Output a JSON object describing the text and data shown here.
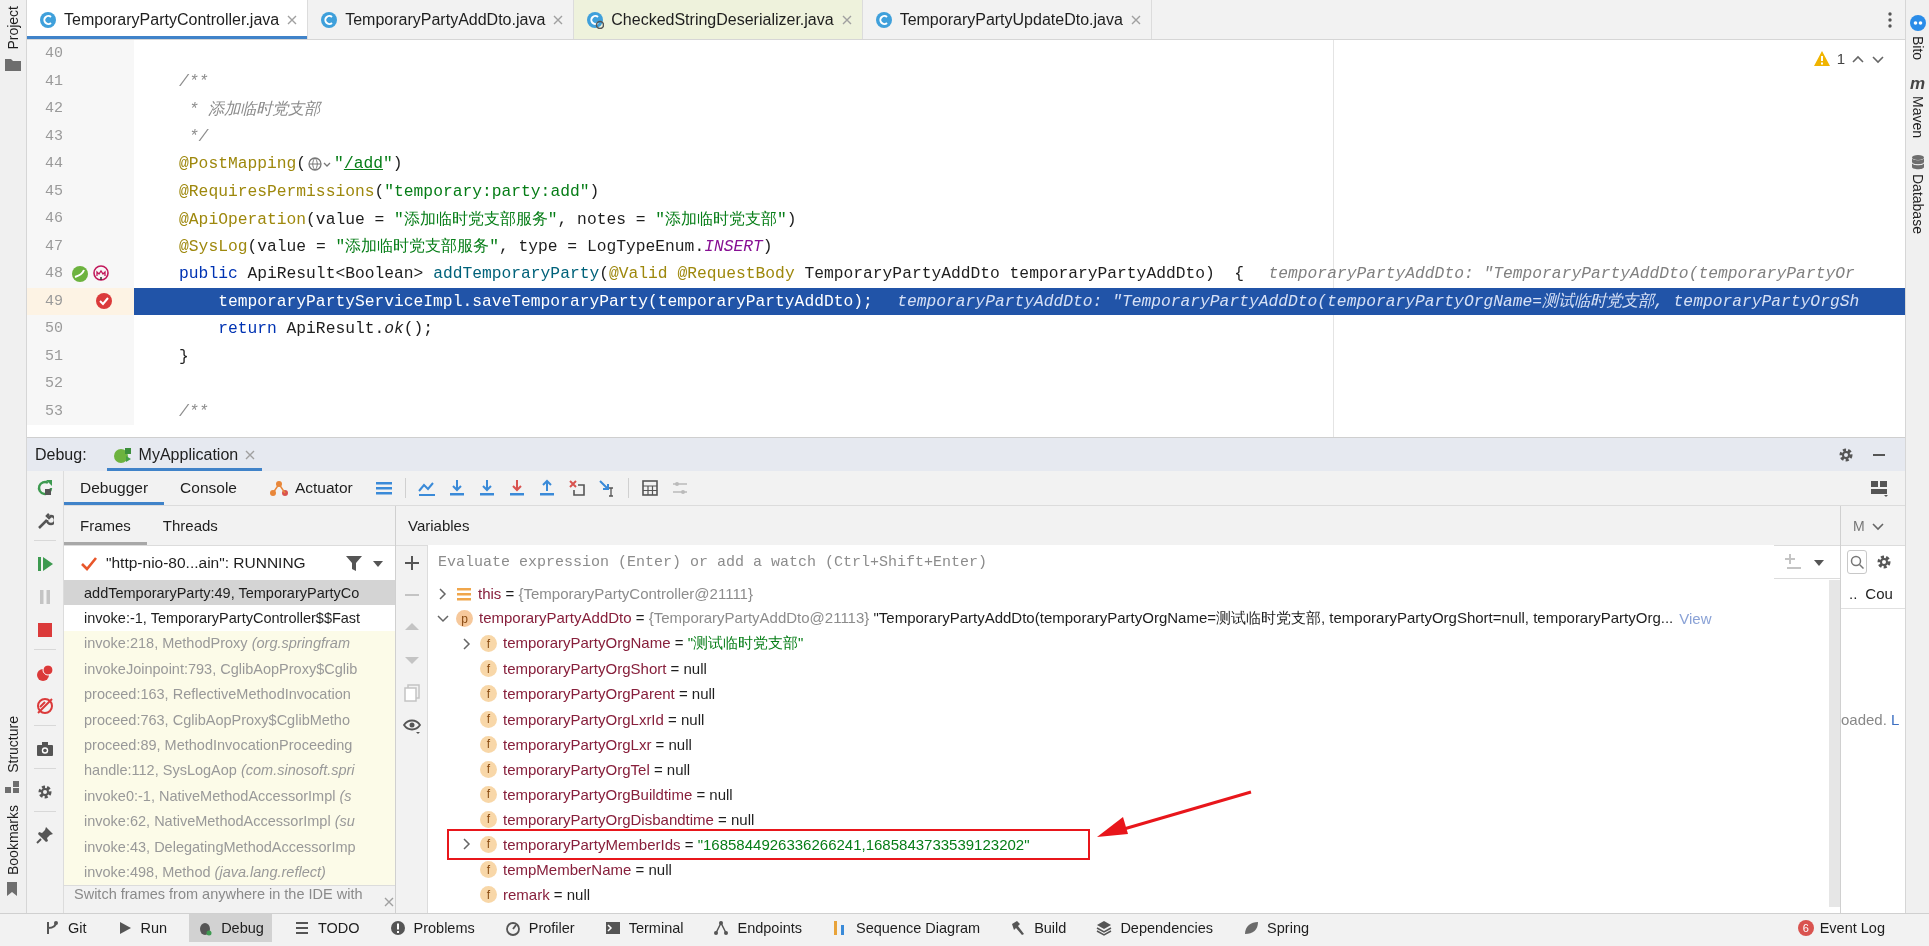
{
  "left_tool_strip": {
    "top": [
      {
        "label": "Project",
        "kind": "folder"
      }
    ],
    "bottom": [
      {
        "label": "Structure",
        "kind": "structure"
      },
      {
        "label": "Bookmarks",
        "kind": "bookmark"
      }
    ]
  },
  "editor_tabs": [
    {
      "label": "TemporaryPartyController.java",
      "selected": true,
      "kind": "project"
    },
    {
      "label": "TemporaryPartyAddDto.java",
      "selected": false,
      "kind": "project"
    },
    {
      "label": "CheckedStringDeserializer.java",
      "selected": false,
      "kind": "library"
    },
    {
      "label": "TemporaryPartyUpdateDto.java",
      "selected": false,
      "kind": "project"
    }
  ],
  "editor": {
    "problems": "1",
    "lines": [
      {
        "number": "40",
        "bean_marker": false,
        "breakpoint": false,
        "current": false
      },
      {
        "number": "41",
        "kind": "member",
        "bean_marker": false,
        "breakpoint": false,
        "current": false,
        "tokens": [
          {
            "kind": "comment",
            "text": "/**"
          }
        ]
      },
      {
        "number": "42",
        "kind": "doc",
        "bean_marker": false,
        "breakpoint": false,
        "current": false,
        "tokens": [
          {
            "kind": "comment",
            "text": "* 添加临时党支部"
          }
        ]
      },
      {
        "number": "43",
        "kind": "doc",
        "bean_marker": false,
        "breakpoint": false,
        "current": false,
        "tokens": [
          {
            "kind": "comment",
            "text": "*/"
          }
        ]
      },
      {
        "number": "44",
        "kind": "member",
        "bean_marker": false,
        "breakpoint": false,
        "current": false,
        "tokens": [
          {
            "kind": "annotation",
            "text": "@PostMapping"
          },
          {
            "kind": "plain",
            "text": "("
          },
          {
            "kind": "globe"
          },
          {
            "kind": "string",
            "text": "\""
          },
          {
            "kind": "link",
            "text": "/add"
          },
          {
            "kind": "string",
            "text": "\""
          },
          {
            "kind": "plain",
            "text": ")"
          }
        ]
      },
      {
        "number": "45",
        "kind": "member",
        "bean_marker": false,
        "breakpoint": false,
        "current": false,
        "tokens": [
          {
            "kind": "annotation",
            "text": "@RequiresPermissions"
          },
          {
            "kind": "plain",
            "text": "("
          },
          {
            "kind": "string",
            "text": "\"temporary:party:add\""
          },
          {
            "kind": "plain",
            "text": ")"
          }
        ]
      },
      {
        "number": "46",
        "kind": "member",
        "bean_marker": false,
        "breakpoint": false,
        "current": false,
        "tokens": [
          {
            "kind": "annotation",
            "text": "@ApiOperation"
          },
          {
            "kind": "plain",
            "text": "(value = "
          },
          {
            "kind": "string",
            "text": "\"添加临时党支部服务\""
          },
          {
            "kind": "plain",
            "text": ", notes = "
          },
          {
            "kind": "string",
            "text": "\"添加临时党支部\""
          },
          {
            "kind": "plain",
            "text": ")"
          }
        ]
      },
      {
        "number": "47",
        "kind": "member",
        "bean_marker": false,
        "breakpoint": false,
        "current": false,
        "tokens": [
          {
            "kind": "annotation",
            "text": "@SysLog"
          },
          {
            "kind": "plain",
            "text": "(value = "
          },
          {
            "kind": "string",
            "text": "\"添加临时党支部服务\""
          },
          {
            "kind": "plain",
            "text": ", type = LogTypeEnum."
          },
          {
            "kind": "constant",
            "text": "INSERT"
          },
          {
            "kind": "plain",
            "text": ")"
          }
        ]
      },
      {
        "number": "48",
        "kind": "member",
        "bean_marker": true,
        "breakpoint": false,
        "current": false,
        "hint": "temporaryPartyAddDto: \"TemporaryPartyAddDto(temporaryPartyOr",
        "tokens": [
          {
            "kind": "keyword",
            "text": "public"
          },
          {
            "kind": "plain",
            "text": " ApiResult<Boolean> "
          },
          {
            "kind": "method",
            "text": "addTemporaryParty"
          },
          {
            "kind": "plain",
            "text": "("
          },
          {
            "kind": "annotation",
            "text": "@Valid @RequestBody"
          },
          {
            "kind": "plain",
            "text": " TemporaryPartyAddDto temporaryPartyAddDto)  {"
          }
        ]
      },
      {
        "number": "49",
        "kind": "body",
        "bean_marker": false,
        "breakpoint": true,
        "current": true,
        "hint": "temporaryPartyAddDto: \"TemporaryPartyAddDto(temporaryPartyOrgName=测试临时党支部, temporaryPartyOrgSh",
        "tokens": [
          {
            "kind": "plain",
            "text": "temporaryPartyServiceImpl.saveTemporaryParty(temporaryPartyAddDto);"
          }
        ]
      },
      {
        "number": "50",
        "kind": "body",
        "bean_marker": false,
        "breakpoint": false,
        "current": false,
        "tokens": [
          {
            "kind": "keyword",
            "text": "return"
          },
          {
            "kind": "plain",
            "text": " ApiResult."
          },
          {
            "kind": "static",
            "text": "ok"
          },
          {
            "kind": "plain",
            "text": "();"
          }
        ]
      },
      {
        "number": "51",
        "kind": "member",
        "bean_marker": false,
        "breakpoint": false,
        "current": false,
        "tokens": [
          {
            "kind": "plain",
            "text": "}"
          }
        ]
      },
      {
        "number": "52",
        "bean_marker": false,
        "breakpoint": false,
        "current": false
      },
      {
        "number": "53",
        "kind": "member",
        "bean_marker": false,
        "breakpoint": false,
        "current": false,
        "tokens": [
          {
            "kind": "comment",
            "text": "/**"
          }
        ]
      }
    ]
  },
  "right_tool_strip": [
    {
      "label": "Bito",
      "kind": "bito"
    },
    {
      "label": "Maven",
      "kind": "maven",
      "badge": "m"
    },
    {
      "label": "Database",
      "kind": "database"
    }
  ],
  "debug": {
    "label": "Debug:",
    "run_tab": {
      "label": "MyApplication",
      "selected": true
    },
    "tabs": [
      {
        "label": "Debugger",
        "selected": true,
        "kind": "plain"
      },
      {
        "label": "Console",
        "selected": false,
        "kind": "plain"
      },
      {
        "label": "Actuator",
        "selected": false,
        "kind": "actuator"
      }
    ],
    "frames_panel": {
      "tabs": [
        {
          "label": "Frames",
          "selected": true
        },
        {
          "label": "Threads",
          "selected": false
        }
      ],
      "thread": "\"http-nio-80...ain\": RUNNING",
      "frames": [
        {
          "text": "addTemporaryParty:49, TemporaryPartyCo",
          "selected": true,
          "kind": "user"
        },
        {
          "text": "invoke:-1, TemporaryPartyController$$Fast",
          "selected": false,
          "kind": "user"
        },
        {
          "text": "invoke:218, MethodProxy *(org.springfram*",
          "selected": false,
          "kind": "library"
        },
        {
          "text": "invokeJoinpoint:793, CglibAopProxy$Cglib",
          "selected": false,
          "kind": "library"
        },
        {
          "text": "proceed:163, ReflectiveMethodInvocation",
          "selected": false,
          "kind": "library"
        },
        {
          "text": "proceed:763, CglibAopProxy$CglibMetho",
          "selected": false,
          "kind": "library"
        },
        {
          "text": "proceed:89, MethodInvocationProceeding",
          "selected": false,
          "kind": "library"
        },
        {
          "text": "handle:112, SysLogAop *(com.sinosoft.spri*",
          "selected": false,
          "kind": "library"
        },
        {
          "text": "invoke0:-1, NativeMethodAccessorImpl *(s*",
          "selected": false,
          "kind": "library"
        },
        {
          "text": "invoke:62, NativeMethodAccessorImpl *(su*",
          "selected": false,
          "kind": "library"
        },
        {
          "text": "invoke:43, DelegatingMethodAccessorImp",
          "selected": false,
          "kind": "library"
        },
        {
          "text": "invoke:498, Method *(java.lang.reflect)*",
          "selected": false,
          "kind": "library"
        }
      ],
      "hint": "Switch frames from anywhere in the IDE with ..."
    },
    "variables_panel": {
      "title": "Variables",
      "placeholder": "Evaluate expression (Enter) or add a watch (Ctrl+Shift+Enter)",
      "variables": [
        {
          "name": "this",
          "kind": "stack_ref",
          "op": "=",
          "value": "{TemporaryPartyController@21111}",
          "expanded": false,
          "highlighted": false
        },
        {
          "name": "temporaryPartyAddDto",
          "kind": "param_ref",
          "badge": "p",
          "op": "=",
          "value": "{TemporaryPartyAddDto@21113}",
          "summary": "\"TemporaryPartyAddDto(temporaryPartyOrgName=测试临时党支部, temporaryPartyOrgShort=null, temporaryPartyOrg...",
          "link": "View",
          "expanded": true,
          "highlighted": false,
          "children": [
            {
              "name": "temporaryPartyOrgName",
              "kind": "field_string",
              "badge": "f",
              "op": "=",
              "value": "\"测试临时党支部\"",
              "expanded": false,
              "highlighted": false
            },
            {
              "name": "temporaryPartyOrgShort",
              "kind": "field_null",
              "badge": "f",
              "op": "=",
              "value": "null",
              "highlighted": false
            },
            {
              "name": "temporaryPartyOrgParent",
              "kind": "field_null",
              "badge": "f",
              "op": "=",
              "value": "null",
              "highlighted": false
            },
            {
              "name": "temporaryPartyOrgLxrId",
              "kind": "field_null",
              "badge": "f",
              "op": "=",
              "value": "null",
              "highlighted": false
            },
            {
              "name": "temporaryPartyOrgLxr",
              "kind": "field_null",
              "badge": "f",
              "op": "=",
              "value": "null",
              "highlighted": false
            },
            {
              "name": "temporaryPartyOrgTel",
              "kind": "field_null",
              "badge": "f",
              "op": "=",
              "value": "null",
              "highlighted": false
            },
            {
              "name": "temporaryPartyOrgBuildtime",
              "kind": "field_null",
              "badge": "f",
              "op": "=",
              "value": "null",
              "highlighted": false
            },
            {
              "name": "temporaryPartyOrgDisbandtime",
              "kind": "field_null",
              "badge": "f",
              "op": "=",
              "value": "null",
              "highlighted": false
            },
            {
              "name": "temporaryPartyMemberIds",
              "kind": "field_string",
              "badge": "f",
              "op": "=",
              "value": "\"1685844926336266241,1685843733539123202\"",
              "expanded": false,
              "highlighted": true
            },
            {
              "name": "tempMemberName",
              "kind": "field_null",
              "badge": "f",
              "op": "=",
              "value": "null",
              "highlighted": false
            },
            {
              "name": "remark",
              "kind": "field_null",
              "badge": "f",
              "op": "=",
              "value": "null",
              "highlighted": false
            }
          ]
        }
      ]
    },
    "side_panel": {
      "header": "M",
      "items": [
        "..",
        "Cou"
      ],
      "message": "oaded.",
      "link": "L"
    }
  },
  "bottom_bar": {
    "items": [
      {
        "label": "Git",
        "kind": "git",
        "selected": false
      },
      {
        "label": "Run",
        "kind": "run",
        "selected": false
      },
      {
        "label": "Debug",
        "kind": "debug",
        "selected": true
      },
      {
        "label": "TODO",
        "kind": "todo",
        "selected": false
      },
      {
        "label": "Problems",
        "kind": "problems",
        "selected": false
      },
      {
        "label": "Profiler",
        "kind": "profiler",
        "selected": false
      },
      {
        "label": "Terminal",
        "kind": "terminal",
        "selected": false
      },
      {
        "label": "Endpoints",
        "kind": "endpoints",
        "selected": false
      },
      {
        "label": "Sequence Diagram",
        "kind": "sequence",
        "selected": false
      },
      {
        "label": "Build",
        "kind": "build",
        "selected": false
      },
      {
        "label": "Dependencies",
        "kind": "dependencies",
        "selected": false
      },
      {
        "label": "Spring",
        "kind": "spring",
        "selected": false
      }
    ],
    "event_log": {
      "label": "Event Log",
      "count": "6"
    }
  }
}
